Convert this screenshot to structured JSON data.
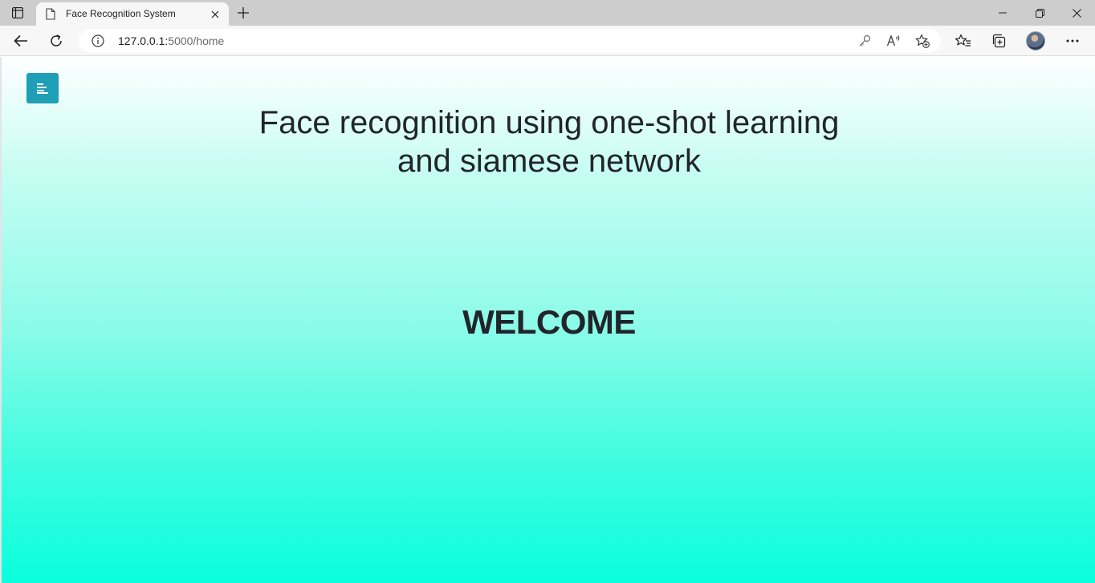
{
  "browser": {
    "tab": {
      "title": "Face Recognition System"
    },
    "address_bar": {
      "url_host": "127.0.0.1:",
      "url_path": "5000/home"
    },
    "icons": {
      "tab_actions": "tab-actions-icon",
      "favicon": "page-icon",
      "tab_close": "close-icon",
      "new_tab": "plus-icon",
      "back": "arrow-left-icon",
      "reload": "reload-icon",
      "info": "info-icon",
      "password_key": "key-icon",
      "read_aloud": "read-aloud-icon",
      "add_favorite": "star-add-icon",
      "favorites": "favorites-icon",
      "collections": "collections-icon",
      "more": "more-icon",
      "minimize": "minimize-icon",
      "restore": "restore-icon",
      "close": "close-icon"
    }
  },
  "page": {
    "heading_line1": "Face recognition using one-shot learning",
    "heading_line2": "and siamese network",
    "welcome": "WELCOME",
    "menu_toggle_icon": "align-left-icon",
    "colors": {
      "menu_button": "#1e9fb6",
      "gradient_top": "#ffffff",
      "gradient_bottom": "#0afedd",
      "text": "#212529"
    }
  }
}
